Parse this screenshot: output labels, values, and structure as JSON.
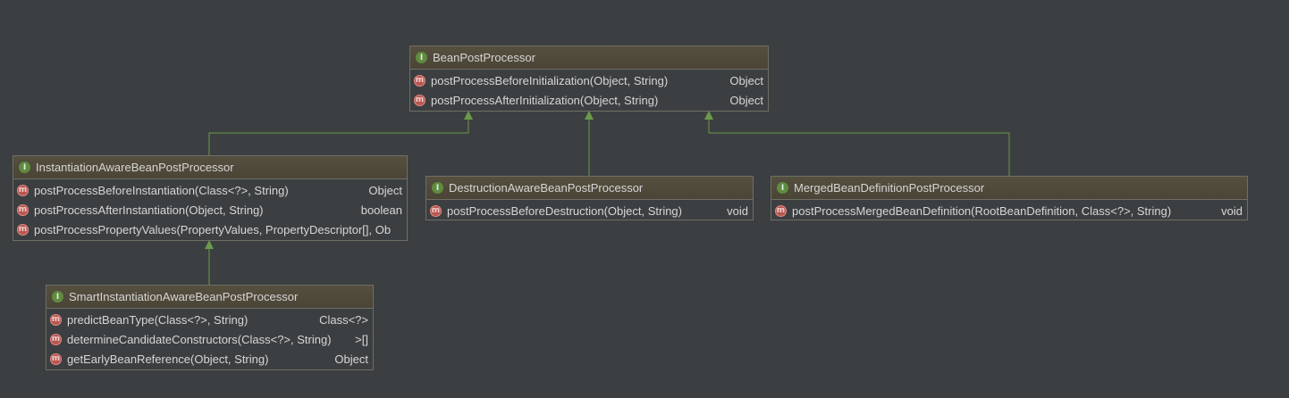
{
  "icons": {
    "interface": "I",
    "method": "m"
  },
  "colors": {
    "background": "#3c3f41",
    "header": "#4e4939",
    "border": "#6f6e66",
    "arrow": "#6a9a4a",
    "interface_icon": "#5f8c3e",
    "method_icon": "#b85752"
  },
  "nodes": {
    "bpp": {
      "name": "BeanPostProcessor",
      "methods": [
        {
          "sig": "postProcessBeforeInitialization(Object, String)",
          "ret": "Object"
        },
        {
          "sig": "postProcessAfterInitialization(Object, String)",
          "ret": "Object"
        }
      ]
    },
    "iabpp": {
      "name": "InstantiationAwareBeanPostProcessor",
      "methods": [
        {
          "sig": "postProcessBeforeInstantiation(Class<?>, String)",
          "ret": "Object"
        },
        {
          "sig": "postProcessAfterInstantiation(Object, String)",
          "ret": "boolean"
        },
        {
          "sig": "postProcessPropertyValues(PropertyValues, PropertyDescriptor[], Ob",
          "ret": ""
        }
      ]
    },
    "dabpp": {
      "name": "DestructionAwareBeanPostProcessor",
      "methods": [
        {
          "sig": "postProcessBeforeDestruction(Object, String)",
          "ret": "void"
        }
      ]
    },
    "mbdpp": {
      "name": "MergedBeanDefinitionPostProcessor",
      "methods": [
        {
          "sig": "postProcessMergedBeanDefinition(RootBeanDefinition, Class<?>, String)",
          "ret": "void"
        }
      ]
    },
    "siabpp": {
      "name": "SmartInstantiationAwareBeanPostProcessor",
      "methods": [
        {
          "sig": "predictBeanType(Class<?>, String)",
          "ret": "Class<?>"
        },
        {
          "sig": "determineCandidateConstructors(Class<?>, String)",
          "ret": ">[]"
        },
        {
          "sig": "getEarlyBeanReference(Object, String)",
          "ret": "Object"
        }
      ]
    }
  }
}
